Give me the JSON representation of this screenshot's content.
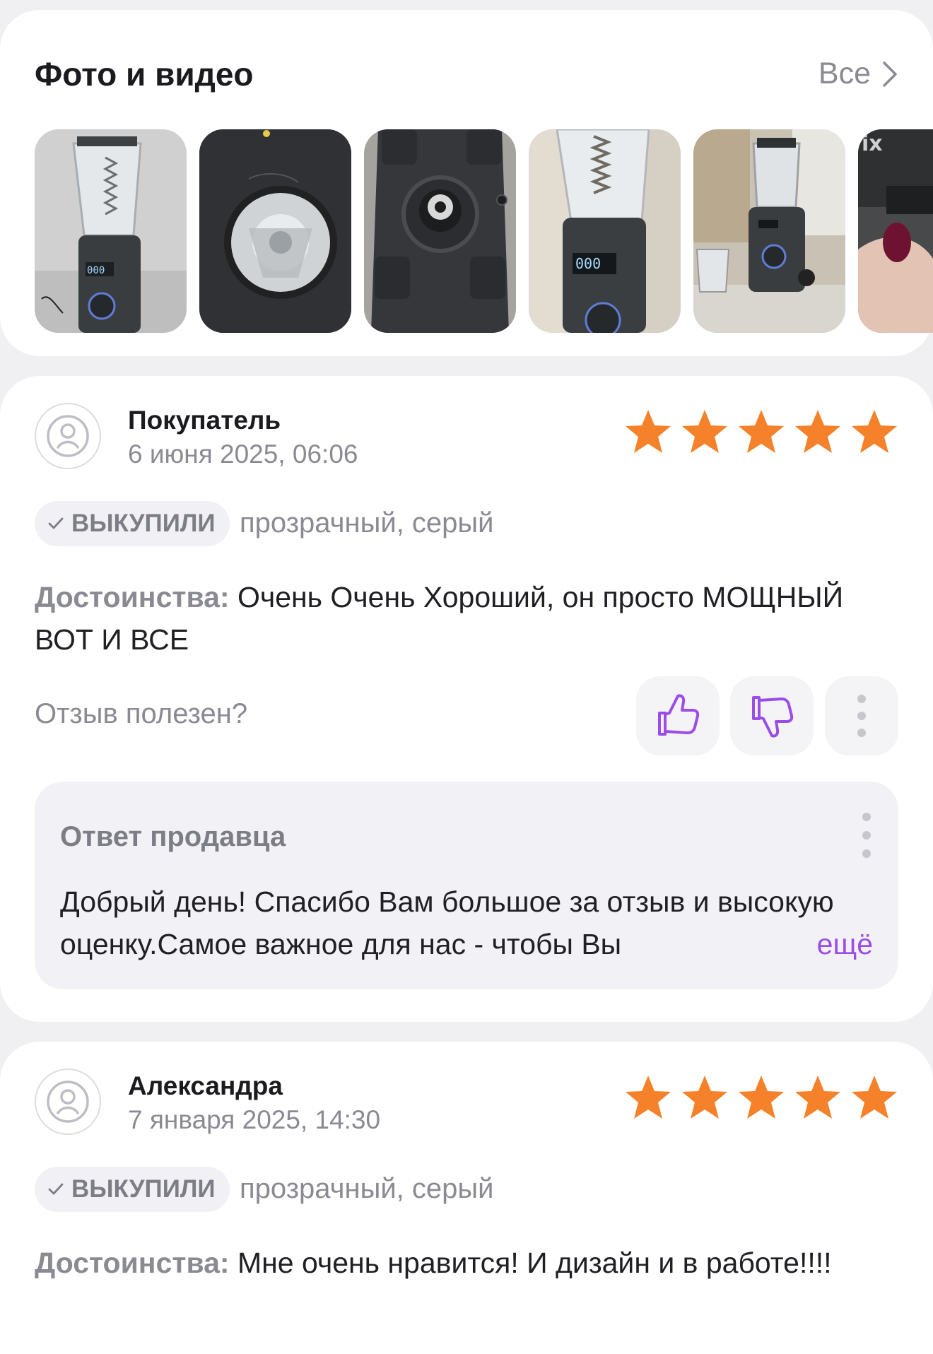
{
  "photos_section": {
    "title": "Фото и видео",
    "all_label": "Все",
    "thumbnails": [
      {
        "name": "blender-photo-1"
      },
      {
        "name": "blender-photo-2"
      },
      {
        "name": "blender-photo-3"
      },
      {
        "name": "blender-photo-4"
      },
      {
        "name": "blender-photo-5"
      },
      {
        "name": "blender-photo-6"
      }
    ],
    "thumbnail_text": {
      "display": "000",
      "overlay": "ix"
    }
  },
  "reviews": [
    {
      "author": "Покупатель",
      "date": "6 июня 2025, 06:06",
      "rating": 5,
      "badge": "ВЫКУПИЛИ",
      "variant": "прозрачный, серый",
      "pros_label": "Достоинства:",
      "pros_text": " Очень Очень Хороший,  он просто МОЩНЫЙ ВОТ И ВСЕ",
      "helpful_label": "Отзыв полезен?",
      "seller_reply": {
        "title": "Ответ продавца",
        "text": "Добрый день! Спасибо Вам большое за отзыв и высокую оценку.Самое важное для нас - чтобы Вы",
        "more_label": "ещё"
      }
    },
    {
      "author": "Александра",
      "date": "7 января 2025, 14:30",
      "rating": 5,
      "badge": "ВЫКУПИЛИ",
      "variant": "прозрачный, серый",
      "pros_label": "Достоинства:",
      "pros_text": " Мне очень нравится! И дизайн и в работе!!!!"
    }
  ],
  "colors": {
    "star": "#f5822a",
    "accent": "#9b4de8",
    "muted_text": "#8a8a93",
    "card_bg": "#ffffff",
    "page_bg": "#f0f0f3"
  },
  "icons": {
    "avatar": "sad-face-icon",
    "thumbs_up": "thumbs-up-icon",
    "thumbs_down": "thumbs-down-icon",
    "more": "more-vertical-icon",
    "check": "check-icon",
    "chevron": "chevron-right-icon",
    "star": "star-icon"
  }
}
